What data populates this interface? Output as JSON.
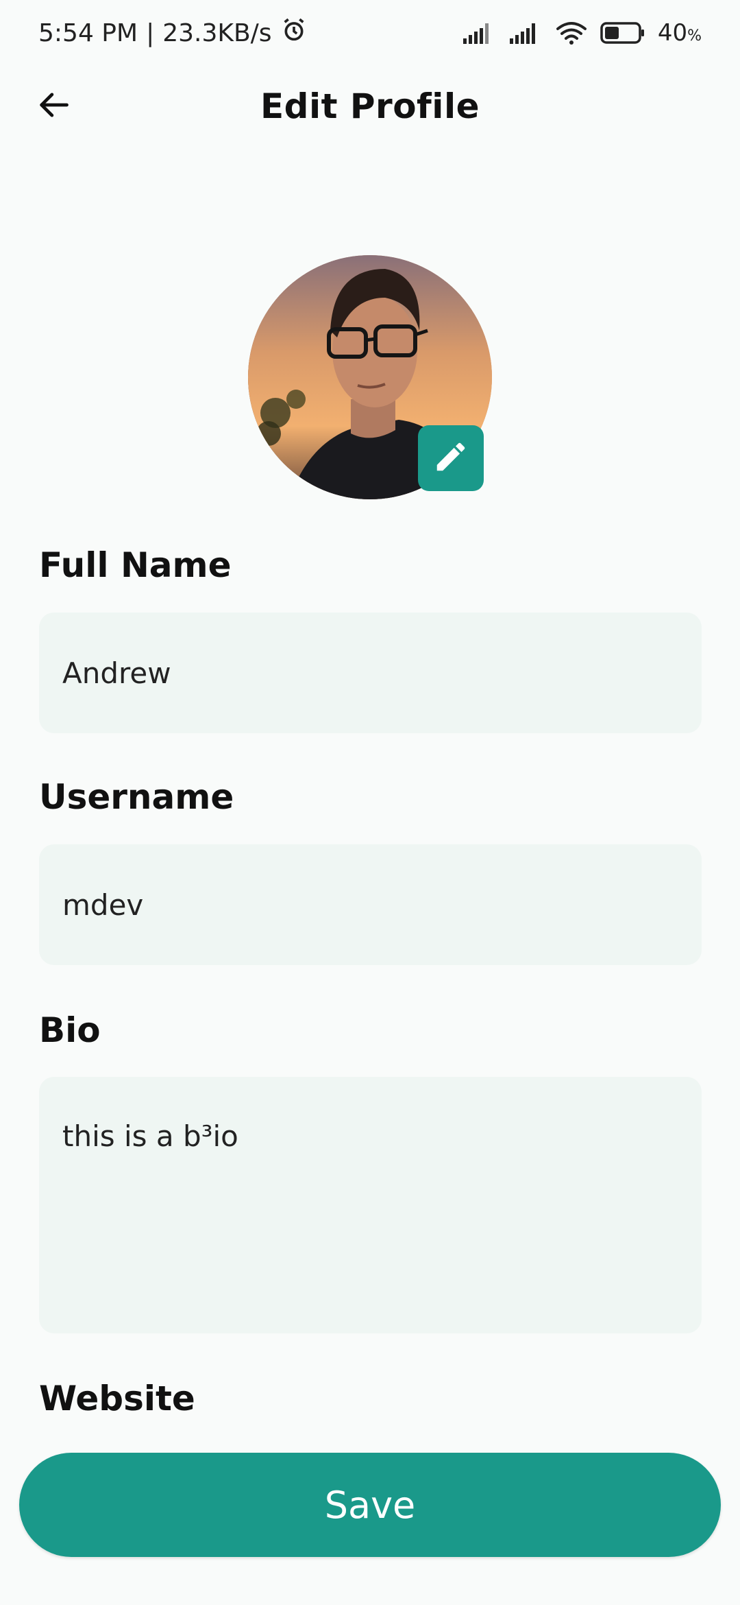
{
  "status_bar": {
    "time": "5:54 PM",
    "separator": "|",
    "speed": "23.3KB/s",
    "battery_percent": "40",
    "battery_unit": "%"
  },
  "header": {
    "title": "Edit Profile",
    "back_icon": "arrow-left-icon"
  },
  "avatar": {
    "edit_icon": "pencil-icon"
  },
  "form": {
    "full_name": {
      "label": "Full Name",
      "value": "Andrew"
    },
    "username": {
      "label": "Username",
      "value": "mdev"
    },
    "bio": {
      "label": "Bio",
      "value": "this is a b³io"
    },
    "website": {
      "label": "Website"
    }
  },
  "actions": {
    "save_label": "Save"
  },
  "colors": {
    "accent": "#1a998a",
    "field_bg": "#eff6f3",
    "page_bg": "#f9fbfa"
  }
}
